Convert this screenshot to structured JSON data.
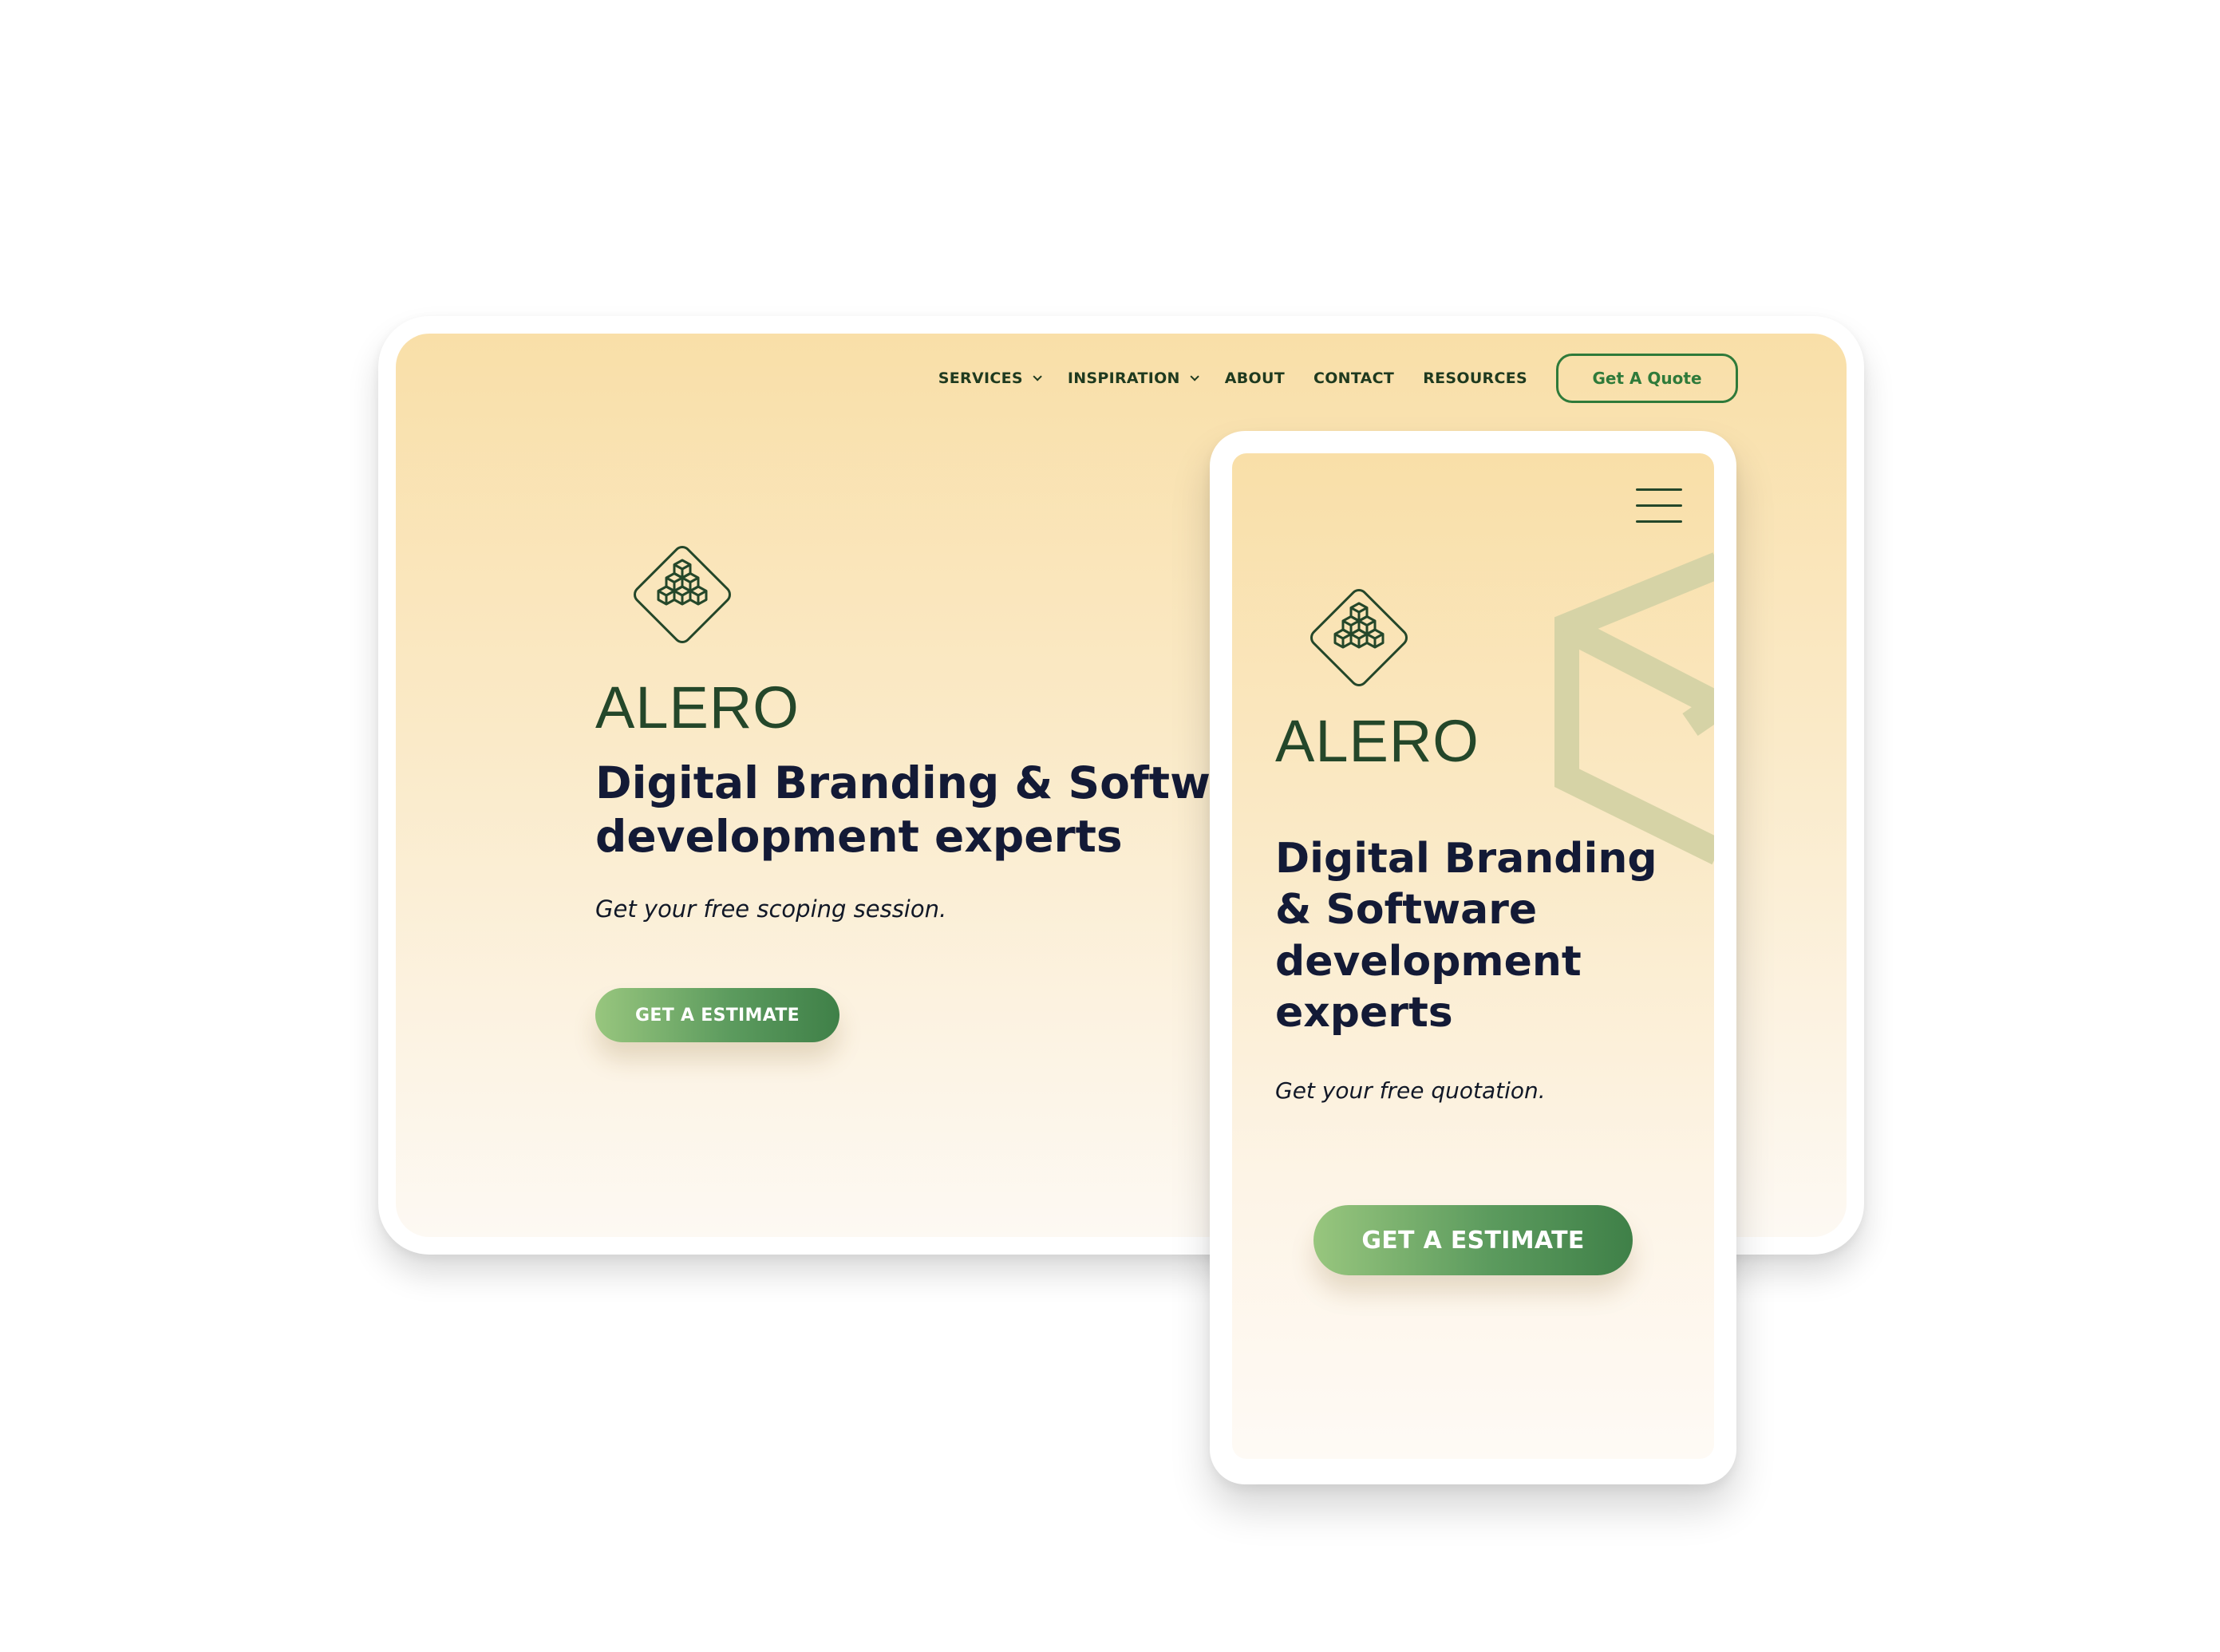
{
  "desktop": {
    "nav": {
      "items": [
        {
          "label": "SERVICES",
          "has_dropdown": true
        },
        {
          "label": "INSPIRATION",
          "has_dropdown": true
        },
        {
          "label": "ABOUT",
          "has_dropdown": false
        },
        {
          "label": "CONTACT",
          "has_dropdown": false
        },
        {
          "label": "RESOURCES",
          "has_dropdown": false
        }
      ],
      "quote_button": "Get A Quote"
    },
    "hero": {
      "logo_icon": "cubes-diamond-icon",
      "brand": "ALERO",
      "title": "Digital Branding & Software development experts",
      "subtitle": "Get your free scoping session.",
      "cta": "GET A ESTIMATE"
    }
  },
  "mobile": {
    "menu_icon": "hamburger-menu-icon",
    "decoration": "hexagon-outline-shape",
    "hero": {
      "logo_icon": "cubes-diamond-icon",
      "brand": "ALERO",
      "title": "Digital Branding & Software development experts",
      "subtitle": "Get your free quotation.",
      "cta": "GET A ESTIMATE"
    }
  },
  "colors": {
    "brand_green": "#24472a",
    "accent_green": "#2f7a3a",
    "heading_navy": "#131a36",
    "background_peach": "#f9dfa8"
  }
}
